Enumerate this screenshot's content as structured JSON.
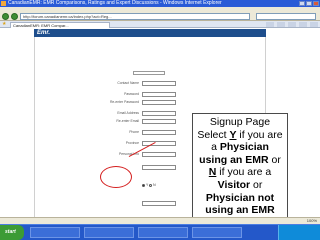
{
  "window": {
    "title": "CanadianEMR: EMR Comparisons, Ratings and Expert Discussions - Windows Internet Explorer",
    "menu": "",
    "url": "http://forum.canadianemr.ca/index.php?act=Reg...",
    "tab_label": "CanadianEMR: EMR Compar..."
  },
  "site": {
    "logo": "Emr."
  },
  "form": {
    "fields": [
      {
        "label": "Contact Name"
      },
      {
        "label": "Password"
      },
      {
        "label": "Re-enter Password"
      },
      {
        "label": "Email Address"
      },
      {
        "label": "Re-enter Email"
      },
      {
        "label": "Phone"
      },
      {
        "label": "Province"
      },
      {
        "label": "Personal Info"
      }
    ],
    "radio_yes": "Y",
    "radio_no": "N",
    "required_note": "* = required field",
    "create_button": "Create User"
  },
  "callout": {
    "line1": "Signup Page",
    "line2_pre": "Select ",
    "line2_key": "Y",
    "line2_post": " if you are",
    "line3_pre": "a ",
    "line3_strong": "Physician",
    "line4_strong": "using an EMR",
    "line4_post": " or",
    "line5_key": "N",
    "line5_post": " if you are a",
    "line6_strong": "Visitor",
    "line6_post": " or",
    "line7_strong": "Physician not",
    "line8_strong": "using an EMR"
  },
  "statusbar": {
    "zoom": "100%"
  },
  "taskbar": {
    "start": "start",
    "clock": ""
  },
  "colors": {
    "annotation_red": "#d41e1e",
    "banner": "#1e4e8c",
    "titlebar": "#2a5bd7"
  }
}
